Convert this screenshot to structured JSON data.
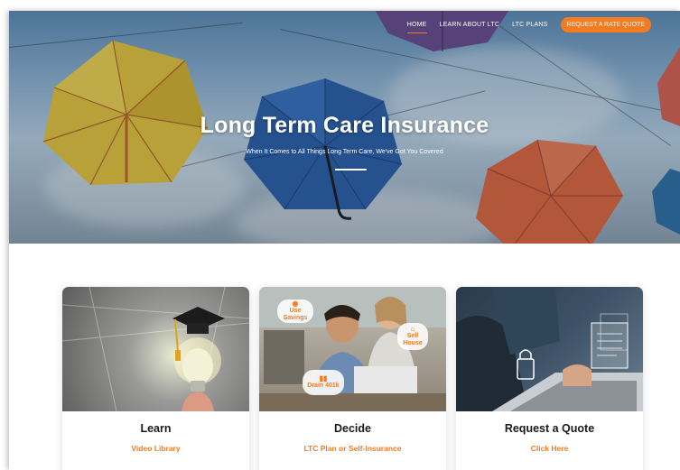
{
  "nav": {
    "items": [
      {
        "label": "HOME",
        "active": true
      },
      {
        "label": "LEARN ABOUT LTC",
        "active": false
      },
      {
        "label": "LTC PLANS",
        "active": false
      }
    ],
    "cta_label": "REQUEST A RATE QUOTE"
  },
  "hero": {
    "title": "Long Term Care Insurance",
    "subtitle": "When It Comes to All Things Long Term Care, We've Got You Covered"
  },
  "cards": [
    {
      "title": "Learn",
      "link": "Video Library"
    },
    {
      "title": "Decide",
      "link": "LTC Plan or Self-Insurance",
      "tags": {
        "savings": "Use Savings",
        "sell": "Sell House",
        "drain": "Drain 401k"
      }
    },
    {
      "title": "Request a Quote",
      "link": "Click Here"
    }
  ],
  "colors": {
    "accent": "#f47b20",
    "text_dark": "#1a1a1a",
    "white": "#ffffff"
  }
}
